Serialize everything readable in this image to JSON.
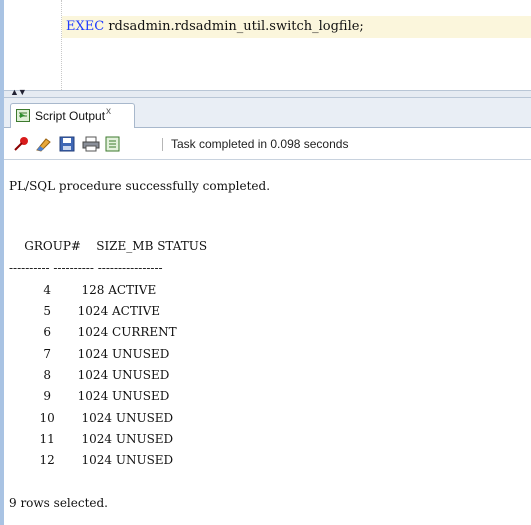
{
  "editor": {
    "keyword": "EXEC",
    "statement": " rdsadmin.rdsadmin_util.switch_logfile;"
  },
  "panel": {
    "tab_label": "Script Output",
    "tab_close": "x",
    "toolbar": {
      "icons": [
        "pin-icon",
        "eraser-icon",
        "save-icon",
        "print-icon",
        "open-script-icon"
      ],
      "status_text": "Task completed in 0.098 seconds"
    }
  },
  "output": {
    "message": "PL/SQL procedure successfully completed.",
    "header": "    GROUP#    SIZE_MB STATUS",
    "separator": "---------- ---------- ----------------",
    "rows": [
      "         4        128 ACTIVE",
      "         5       1024 ACTIVE",
      "         6       1024 CURRENT",
      "         7       1024 UNUSED",
      "         8       1024 UNUSED",
      "         9       1024 UNUSED",
      "        10       1024 UNUSED",
      "        11       1024 UNUSED",
      "        12       1024 UNUSED"
    ],
    "footer": "9 rows selected."
  }
}
